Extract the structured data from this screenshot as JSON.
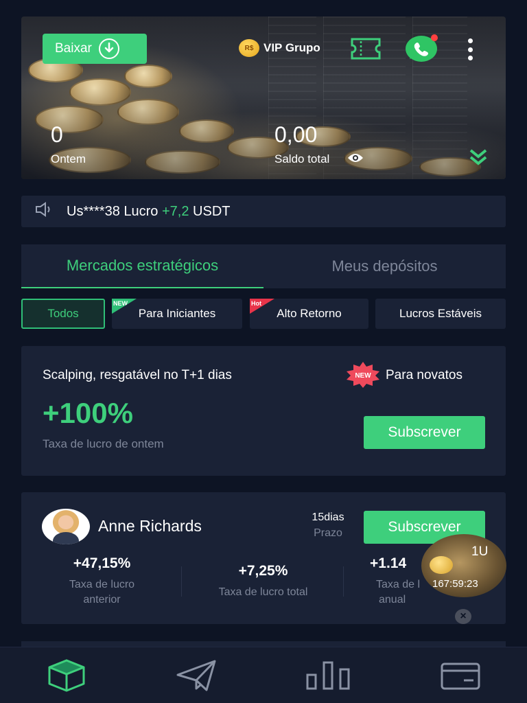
{
  "header": {
    "download_label": "Baixar",
    "vip_badge": "R$",
    "vip_label": "VIP Grupo",
    "yesterday_value": "0",
    "yesterday_label": "Ontem",
    "balance_value": "0,00",
    "balance_label": "Saldo total"
  },
  "notice": {
    "prefix": "Us****38 Lucro",
    "amount": "+7,2",
    "currency": "USDT"
  },
  "tabs": [
    {
      "label": "Mercados estratégicos",
      "active": true
    },
    {
      "label": "Meus depósitos",
      "active": false
    }
  ],
  "filters": [
    {
      "label": "Todos",
      "active": true,
      "tag": ""
    },
    {
      "label": "Para Iniciantes",
      "active": false,
      "tag": "NEW"
    },
    {
      "label": "Alto Retorno",
      "active": false,
      "tag": "Hot"
    },
    {
      "label": "Lucros Estáveis",
      "active": false,
      "tag": ""
    }
  ],
  "card1": {
    "title": "Scalping, resgatável no T+1 dias",
    "new_badge": "NEW",
    "audience": "Para novatos",
    "rate": "+100%",
    "rate_label": "Taxa de lucro de ontem",
    "subscribe_label": "Subscrever"
  },
  "card2": {
    "name": "Anne Richards",
    "days": "15dias",
    "days_label": "Prazo",
    "subscribe_label": "Subscrever",
    "metrics": [
      {
        "value": "+47,15%",
        "label_line1": "Taxa de lucro",
        "label_line2": "anterior"
      },
      {
        "value": "+7,25%",
        "label_line1": "Taxa de lucro total",
        "label_line2": ""
      },
      {
        "value": "+1.14",
        "label_line1": "Taxa de l",
        "label_line2": "anual"
      }
    ]
  },
  "floating": {
    "amount": "1U",
    "countdown": "167:59:23"
  },
  "colors": {
    "accent": "#3ecf7c",
    "background": "#0d1424",
    "card": "#1a2236",
    "muted_text": "#7e8699"
  },
  "icons": {
    "download": "download-icon",
    "ticket": "ticket-icon",
    "whatsapp": "whatsapp-icon",
    "more": "more-vertical-icon",
    "eye": "eye-icon",
    "expand": "chevron-double-down-icon",
    "speaker": "speaker-icon",
    "nav": [
      "cube-icon",
      "send-icon",
      "bar-chart-icon",
      "wallet-icon"
    ]
  }
}
